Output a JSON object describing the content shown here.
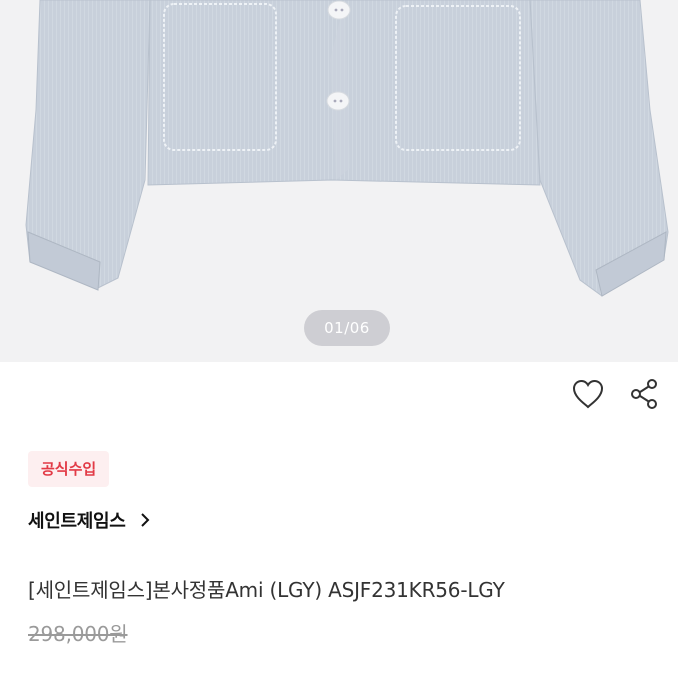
{
  "gallery": {
    "page_indicator": "01/06",
    "image_alt": "light grey cropped jacket with patch pockets",
    "jacket_color": "#c9d1dc"
  },
  "actions": {
    "like_icon": "heart-icon",
    "share_icon": "share-icon"
  },
  "badge": {
    "label": "공식수입",
    "text_color": "#e23a46",
    "bg_color": "#fdeff0"
  },
  "brand": {
    "name": "세인트제임스",
    "chevron_icon": "chevron-right-icon"
  },
  "product": {
    "title": "[세인트제임스]본사정품Ami (LGY) ASJF231KR56-LGY",
    "original_price": "298,000원"
  }
}
